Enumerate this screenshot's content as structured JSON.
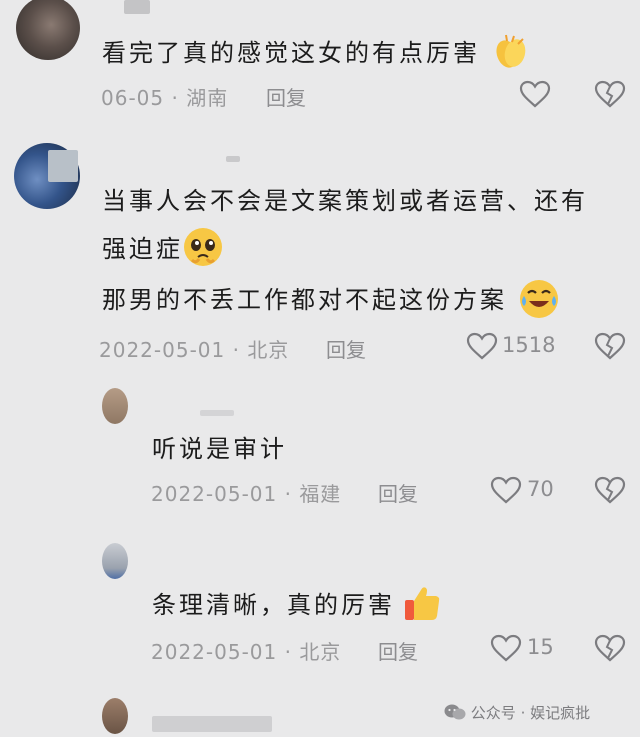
{
  "comments": [
    {
      "text": "看完了真的感觉这女的有点厉害",
      "emoji": "clapping-hands",
      "date": "06-05",
      "separator": "·",
      "location": "湖南",
      "reply_label": "回复",
      "likes": ""
    },
    {
      "text_line1": "当事人会不会是文案策划或者运营、还有",
      "text_line2": "强迫症",
      "emoji1": "pleading-face",
      "text_line3": "那男的不丢工作都对不起这份方案",
      "emoji2": "tears-of-joy",
      "date": "2022-05-01",
      "separator": "·",
      "location": "北京",
      "reply_label": "回复",
      "likes": "1518"
    }
  ],
  "replies": [
    {
      "text": "听说是审计",
      "date": "2022-05-01",
      "separator": "·",
      "location": "福建",
      "reply_label": "回复",
      "likes": "70"
    },
    {
      "text": "条理清晰，真的厉害",
      "emoji": "thumbs-up",
      "date": "2022-05-01",
      "separator": "·",
      "location": "北京",
      "reply_label": "回复",
      "likes": "15"
    }
  ],
  "watermark": {
    "channel": "公众号",
    "separator": "·",
    "name": "娱记疯批"
  },
  "colors": {
    "background": "#e9e9ea",
    "text": "#1c1c1c",
    "meta": "#9a9a9c",
    "icon": "#7c7c80"
  }
}
